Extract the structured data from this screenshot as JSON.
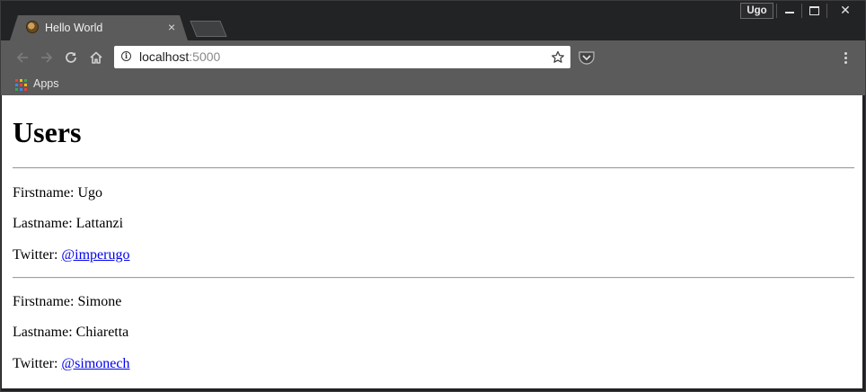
{
  "browser": {
    "tab": {
      "title": "Hello World",
      "close_glyph": "×"
    },
    "profile_label": "Ugo",
    "window_controls": {
      "close_glyph": "✕"
    },
    "address": {
      "host": "localhost",
      "port": ":5000"
    },
    "bookmarks": {
      "apps_label": "Apps"
    },
    "icons": {
      "favicon": "favicon-icon",
      "back": "back-arrow-icon",
      "forward": "forward-arrow-icon",
      "reload": "reload-icon",
      "home": "home-icon",
      "info": "info-icon",
      "star": "star-icon",
      "extension": "pocket-extension-icon",
      "menu": "kebab-menu-icon",
      "apps": "apps-grid-icon"
    }
  },
  "page": {
    "heading": "Users",
    "users": [
      {
        "firstname": "Firstname: Ugo",
        "lastname": "Lastname: Lattanzi",
        "twitter_prefix": "Twitter: ",
        "twitter_handle": "@imperugo"
      },
      {
        "firstname": "Firstname: Simone",
        "lastname": "Lastname: Chiaretta",
        "twitter_prefix": "Twitter: ",
        "twitter_handle": "@simonech"
      }
    ]
  },
  "colors": {
    "chrome_dark": "#222325",
    "toolbar": "#5b5b5b",
    "link": "#0000ee"
  }
}
